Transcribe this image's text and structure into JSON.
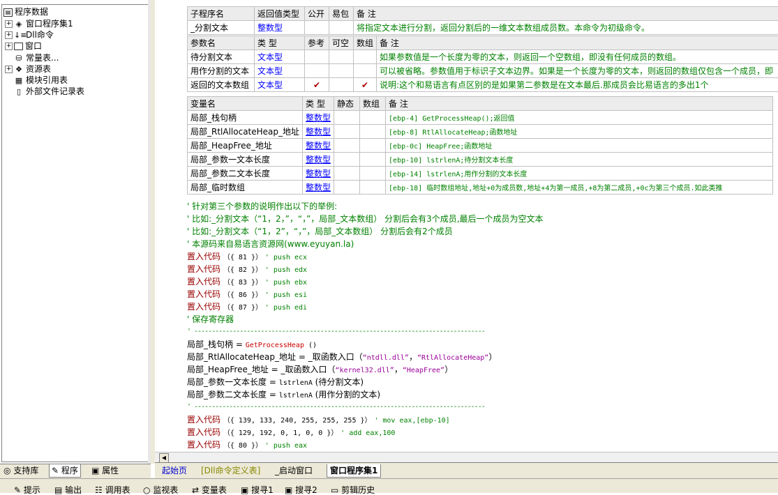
{
  "left_panel": {
    "tree": [
      {
        "label": "程序数据",
        "icon": "database-icon",
        "expander": ""
      },
      {
        "label": "窗口程序集1",
        "icon": "layers-icon",
        "expander": "+"
      },
      {
        "label": "Dll命令",
        "icon": "dll-icon",
        "expander": "+"
      },
      {
        "label": "窗口",
        "icon": "window-icon",
        "expander": "+"
      },
      {
        "label": "常量表...",
        "icon": "constant-table-icon",
        "expander": ""
      },
      {
        "label": "资源表",
        "icon": "resource-icon",
        "expander": "+"
      },
      {
        "label": "模块引用表",
        "icon": "module-icon",
        "expander": ""
      },
      {
        "label": "外部文件记录表",
        "icon": "file-record-icon",
        "expander": ""
      }
    ],
    "tabs": [
      "支持库",
      "程序",
      "属性"
    ]
  },
  "sub_table": {
    "headers": [
      "子程序名",
      "返回值类型",
      "公开",
      "易包",
      "备 注"
    ],
    "row": {
      "name": "_分割文本",
      "type": "整数型",
      "public": "",
      "easy": "",
      "note": "将指定文本进行分割，返回分割后的一维文本数组成员数。本命令为初级命令。"
    }
  },
  "param_table": {
    "headers": [
      "参数名",
      "类 型",
      "参考",
      "可空",
      "数组",
      "备 注"
    ],
    "rows": [
      {
        "name": "待分割文本",
        "type": "文本型",
        "ref": "",
        "nullable": "",
        "array": "",
        "note": "如果参数值是一个长度为零的文本，则返回一个空数组，即没有任何成员的数组。"
      },
      {
        "name": "用作分割的文本",
        "type": "文本型",
        "ref": "",
        "nullable": "",
        "array": "",
        "note": "可以被省略。参数值用于标识子文本边界。如果是一个长度为零的文本，则返回的数组仅包含一个成员，即"
      },
      {
        "name": "返回的文本数组",
        "type": "文本型",
        "ref": "✔",
        "nullable": "",
        "array": "✔",
        "note": "说明:这个和易语言有点区别的是如果第二参数是在文本最后.那成员会比易语言的多出1个"
      }
    ]
  },
  "var_table": {
    "headers": [
      "变量名",
      "类 型",
      "静态",
      "数组",
      "备 注"
    ],
    "rows": [
      {
        "name": "局部_栈句柄",
        "type": "整数型",
        "note": "[ebp-4] GetProcessHeap();返回值"
      },
      {
        "name": "局部_RtlAllocateHeap_地址",
        "type": "整数型",
        "note": "[ebp-8] RtlAllocateHeap;函数地址"
      },
      {
        "name": "局部_HeapFree_地址",
        "type": "整数型",
        "note": "[ebp-0c] HeapFree;函数地址"
      },
      {
        "name": "局部_参数一文本长度",
        "type": "整数型",
        "note": "[ebp-10] lstrlenA;待分割文本长度"
      },
      {
        "name": "局部_参数二文本长度",
        "type": "整数型",
        "note": "[ebp-14] lstrlenA;用作分割的文本长度"
      },
      {
        "name": "局部_临时数组",
        "type": "整数型",
        "note": "[ebp-18] 临时数组地址,地址+0为成员数,地址+4为第一成员,+8为第二成员,+0c为第三个成员.如此类推"
      }
    ]
  },
  "code": {
    "c1": "' 针对第三个参数的说明作出以下的举例:",
    "c2": "' 比如:_分割文本（“1，2，”，“，”，局部_文本数组） 分割后会有3个成员,最后一个成员为空文本",
    "c3": "' 比如:_分割文本（“1，2”，“，”，局部_文本数组） 分割后会有2个成员",
    "c4": "' 本源码来自易语言资源网(www.eyuyan.la)",
    "emit1": {
      "kw": "置入代码",
      "args": "（{ 81 }）",
      "cmt": "' push ecx"
    },
    "emit2": {
      "kw": "置入代码",
      "args": "（{ 82 }）",
      "cmt": "' push edx"
    },
    "emit3": {
      "kw": "置入代码",
      "args": "（{ 83 }）",
      "cmt": "' push ebx"
    },
    "emit4": {
      "kw": "置入代码",
      "args": "（{ 86 }）",
      "cmt": "' push esi"
    },
    "emit5": {
      "kw": "置入代码",
      "args": "（{ 87 }）",
      "cmt": "' push edi"
    },
    "c5": "' 保存寄存器",
    "sep1": "' -----------------------------------------------------------------------------------",
    "a1": {
      "lhs": "局部_栈句柄 = ",
      "fn": "GetProcessHeap",
      "rest": " ()"
    },
    "a2": {
      "lhs": "局部_RtlAllocateHeap_地址 = _取函数入口（",
      "s1": "“ntdll.dll”",
      "mid": "，",
      "s2": "“RtlAllocateHeap”",
      "end": "）"
    },
    "a3": {
      "lhs": "局部_HeapFree_地址 = _取函数入口（",
      "s1": "“kernel32.dll”",
      "mid": "，",
      "s2": "“HeapFree”",
      "end": "）"
    },
    "a4": {
      "lhs": "局部_参数一文本长度 = ",
      "fn": "lstrlenA",
      "rest": " (待分割文本)"
    },
    "a5": {
      "lhs": "局部_参数二文本长度 = ",
      "fn": "lstrlenA",
      "rest": " (用作分割的文本)"
    },
    "sep2": "' -----------------------------------------------------------------------------------",
    "emit6": {
      "kw": "置入代码",
      "args": "（{ 139, 133, 240, 255, 255, 255 }）",
      "cmt": "' mov eax,[ebp-10]"
    },
    "emit7": {
      "kw": "置入代码",
      "args": "（{ 129, 192, 0, 1, 0, 0 }）",
      "cmt": "' add eax,100"
    },
    "emit8": {
      "kw": "置入代码",
      "args": "（{ 80 }）",
      "cmt": "' push eax"
    }
  },
  "doc_tabs": [
    "起始页",
    "[Dll命令定义表]",
    "_启动窗口",
    "窗口程序集1"
  ],
  "bottom_tabs": [
    "提示",
    "输出",
    "调用表",
    "监视表",
    "变量表",
    "搜寻1",
    "搜寻2",
    "剪辑历史"
  ]
}
